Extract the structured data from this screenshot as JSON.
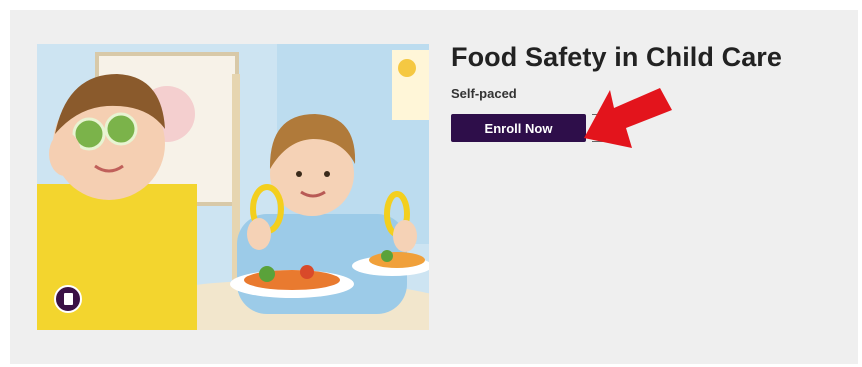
{
  "course": {
    "title": "Food Safety in Child Care",
    "pace": "Self-paced",
    "enroll_label": "Enroll Now",
    "image_alt": "Two children eating vegetables"
  },
  "badge": {
    "icon": "book-icon"
  },
  "annotation": {
    "icon": "red-arrow-icon",
    "color": "#e3141c"
  },
  "colors": {
    "background": "#efefef",
    "button": "#2e0e4a",
    "badge": "#3a1145"
  }
}
